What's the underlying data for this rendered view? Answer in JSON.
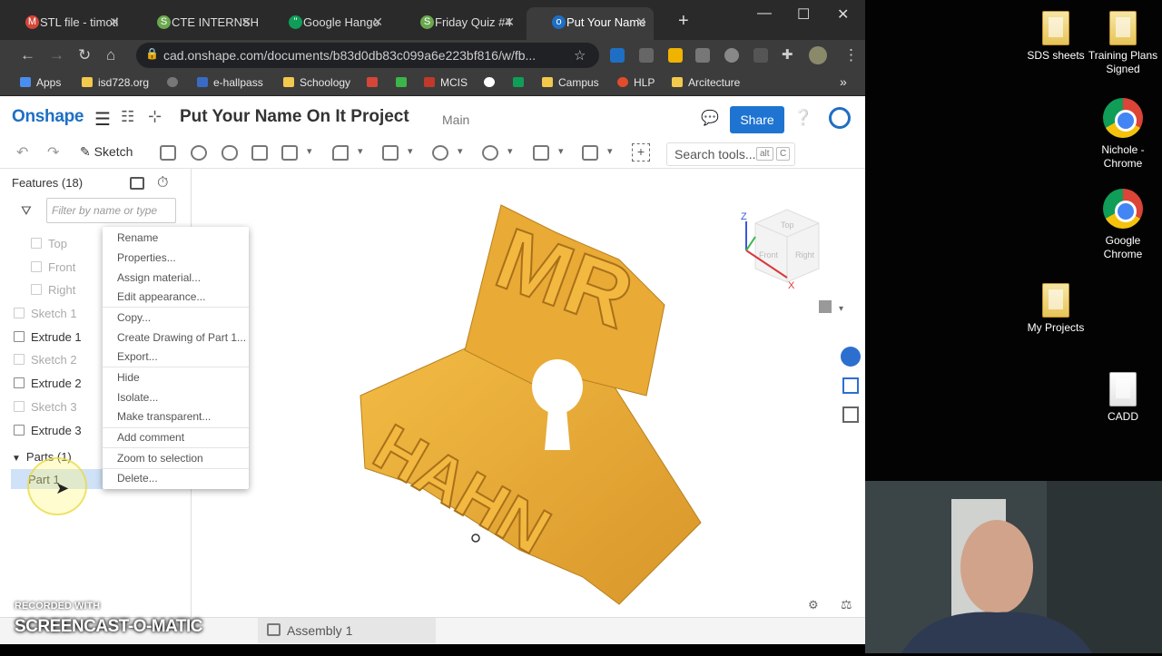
{
  "browser_tabs": [
    {
      "title": "STL file - timotl",
      "icon_color": "#d44638"
    },
    {
      "title": "CTE INTERNSH",
      "icon_color": "#6aa84f"
    },
    {
      "title": "Google Hango",
      "icon_color": "#0f9d58"
    },
    {
      "title": "Friday Quiz #4",
      "icon_color": "#6aa84f"
    },
    {
      "title": "Put Your Name",
      "icon_color": "#1e6fc4"
    }
  ],
  "new_tab": "+",
  "url": "cad.onshape.com/documents/b83d0db83c099a6e223bf816/w/fb...",
  "bookmarks": [
    "Apps",
    "isd728.org",
    "e-hallpass",
    "Schoology",
    "MCIS",
    "Campus",
    "HLP",
    "Arcitecture"
  ],
  "app": {
    "logo": "Onshape",
    "doc_title": "Put Your Name On It Project",
    "branch": "Main",
    "share": "Share"
  },
  "toolbar": {
    "sketch": "Sketch",
    "search": "Search tools...",
    "kbd1": "alt",
    "kbd2": "C"
  },
  "features": {
    "header": "Features (18)",
    "filter_placeholder": "Filter by name or type",
    "planes": [
      "Top",
      "Front",
      "Right"
    ],
    "items": [
      "Sketch 1",
      "Extrude 1",
      "Sketch 2",
      "Extrude 2",
      "Sketch 3",
      "Extrude 3"
    ],
    "parts_header": "Parts (1)",
    "part": "Part 1"
  },
  "context_menu": [
    "Rename",
    "Properties...",
    "Assign material...",
    "Edit appearance...",
    "Copy...",
    "Create Drawing of Part 1...",
    "Export...",
    "Hide",
    "Isolate...",
    "Make transparent...",
    "Add comment",
    "Zoom to selection",
    "Delete..."
  ],
  "viewcube": {
    "top": "Top",
    "front": "Front",
    "right": "Right",
    "z": "Z",
    "x": "X"
  },
  "bottom_tab": "Assembly 1",
  "desktop_icons": [
    "SDS sheets",
    "Training Plans Signed",
    "Nichole - Chrome",
    "Google Chrome",
    "My Projects",
    "CADD"
  ],
  "watermark": {
    "line1": "RECORDED WITH",
    "line2": "SCREENCAST-O-MATIC"
  },
  "model_text": {
    "line1": "MR",
    "line2": "HAHN"
  },
  "colors": {
    "accent": "#1f74d1",
    "model": "#e8a932"
  }
}
